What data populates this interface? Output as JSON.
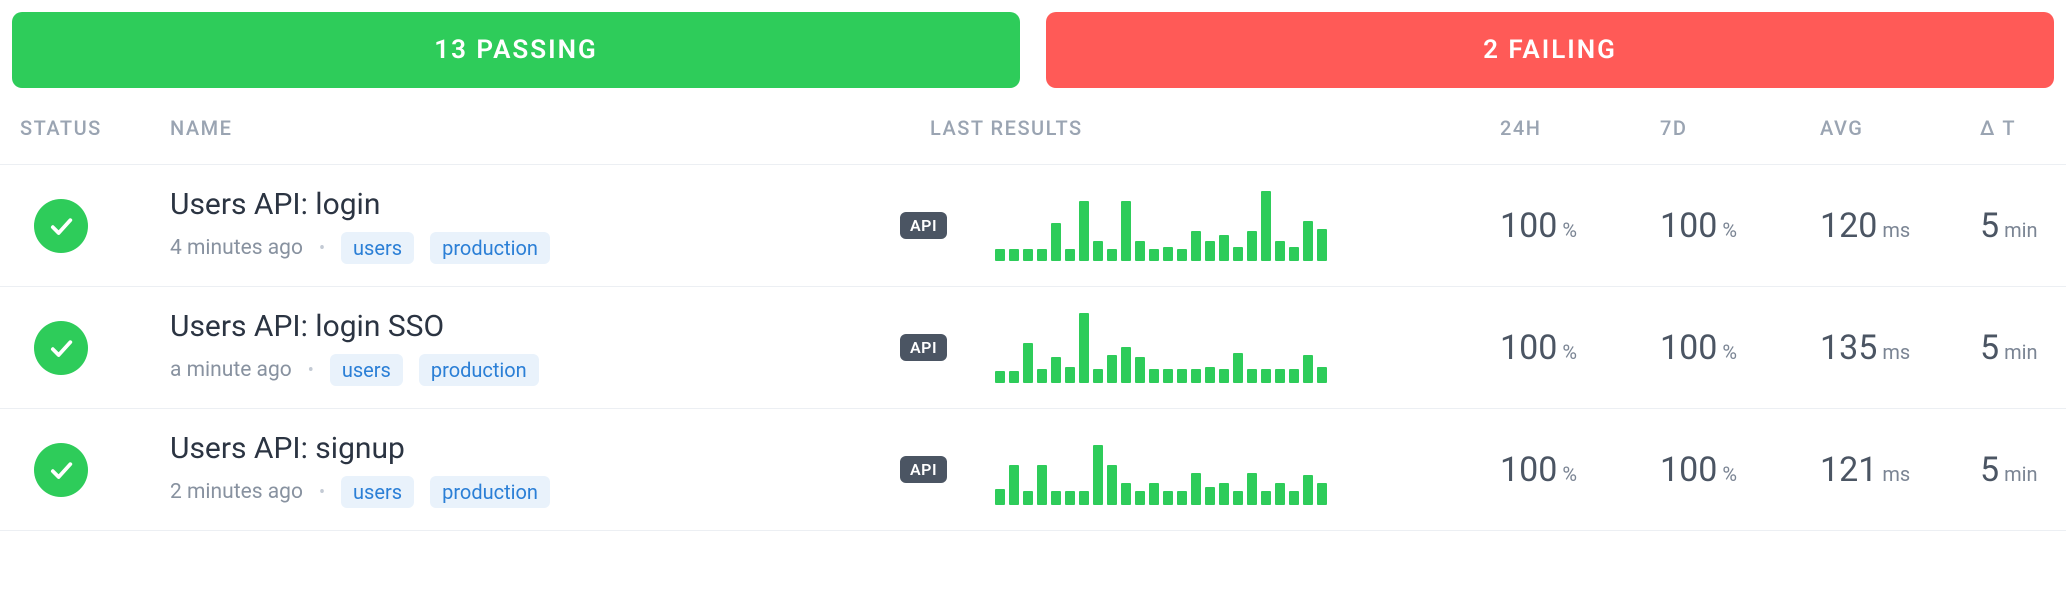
{
  "summary": {
    "passing_label": "13 PASSING",
    "failing_label": "2 FAILING"
  },
  "headers": {
    "status": "STATUS",
    "name": "NAME",
    "last_results": "LAST RESULTS",
    "h24": "24H",
    "d7": "7D",
    "avg": "AVG",
    "delta_t": "Δ T"
  },
  "labels": {
    "api_chip": "API"
  },
  "rows": [
    {
      "name": "Users API: login",
      "ago": "4 minutes ago",
      "tags": [
        "users",
        "production"
      ],
      "spark": [
        12,
        12,
        12,
        12,
        38,
        12,
        60,
        20,
        12,
        60,
        20,
        12,
        14,
        12,
        30,
        20,
        26,
        14,
        30,
        70,
        20,
        14,
        40,
        32
      ],
      "h24": "100",
      "h24_unit": "%",
      "d7": "100",
      "d7_unit": "%",
      "avg": "120",
      "avg_unit": "ms",
      "dt": "5",
      "dt_unit": "min"
    },
    {
      "name": "Users API: login SSO",
      "ago": "a minute ago",
      "tags": [
        "users",
        "production"
      ],
      "spark": [
        12,
        12,
        40,
        14,
        26,
        16,
        70,
        14,
        28,
        36,
        26,
        14,
        14,
        14,
        14,
        16,
        14,
        30,
        14,
        14,
        14,
        14,
        28,
        16
      ],
      "h24": "100",
      "h24_unit": "%",
      "d7": "100",
      "d7_unit": "%",
      "avg": "135",
      "avg_unit": "ms",
      "dt": "5",
      "dt_unit": "min"
    },
    {
      "name": "Users API: signup",
      "ago": "2 minutes ago",
      "tags": [
        "users",
        "production"
      ],
      "spark": [
        16,
        40,
        14,
        40,
        14,
        14,
        14,
        60,
        40,
        22,
        14,
        22,
        14,
        14,
        32,
        18,
        22,
        14,
        32,
        14,
        22,
        14,
        30,
        22
      ],
      "h24": "100",
      "h24_unit": "%",
      "d7": "100",
      "d7_unit": "%",
      "avg": "121",
      "avg_unit": "ms",
      "dt": "5",
      "dt_unit": "min"
    }
  ]
}
